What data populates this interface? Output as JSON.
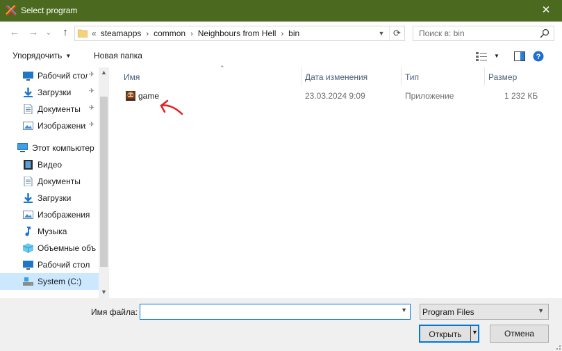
{
  "window": {
    "title": "Select program",
    "close_glyph": "✕"
  },
  "nav": {
    "back_glyph": "←",
    "forward_glyph": "→",
    "recent_glyph": "⌄",
    "up_glyph": "↑",
    "address_prefix": "«",
    "breadcrumbs": [
      "steamapps",
      "common",
      "Neighbours from Hell",
      "bin"
    ],
    "refresh_glyph": "⟳",
    "search_placeholder": "Поиск в: bin"
  },
  "commands": {
    "organize": "Упорядочить",
    "new_folder": "Новая папка"
  },
  "sidebar": {
    "quick_access": [
      {
        "label": "Рабочий стол",
        "icon": "desktop-icon",
        "pinned": true
      },
      {
        "label": "Загрузки",
        "icon": "downloads-icon",
        "pinned": true
      },
      {
        "label": "Документы",
        "icon": "documents-icon",
        "pinned": true
      },
      {
        "label": "Изображения",
        "icon": "pictures-icon",
        "pinned": true
      }
    ],
    "this_pc": "Этот компьютер",
    "pc_items": [
      {
        "label": "Видео",
        "icon": "video-icon"
      },
      {
        "label": "Документы",
        "icon": "documents-icon"
      },
      {
        "label": "Загрузки",
        "icon": "downloads-icon"
      },
      {
        "label": "Изображения",
        "icon": "pictures-icon"
      },
      {
        "label": "Музыка",
        "icon": "music-icon"
      },
      {
        "label": "Объемные объ",
        "icon": "3d-objects-icon"
      },
      {
        "label": "Рабочий стол",
        "icon": "desktop-icon"
      },
      {
        "label": "System (C:)",
        "icon": "drive-icon",
        "selected": true
      }
    ],
    "pin_glyph": "📌"
  },
  "table": {
    "columns": [
      "Имя",
      "Дата изменения",
      "Тип",
      "Размер"
    ],
    "sort_glyph": "⌃",
    "rows": [
      {
        "name": "game",
        "modified": "23.03.2024 9:09",
        "type": "Приложение",
        "size": "1 232 КБ"
      }
    ]
  },
  "footer": {
    "filename_label": "Имя файла:",
    "filename_value": "",
    "filter_value": "Program Files",
    "open_label": "Открыть",
    "cancel_label": "Отмена"
  },
  "colors": {
    "titlebar": "#4c6a1f",
    "accent": "#0078d7",
    "selection": "#cce8ff",
    "annotation": "#e02020"
  }
}
